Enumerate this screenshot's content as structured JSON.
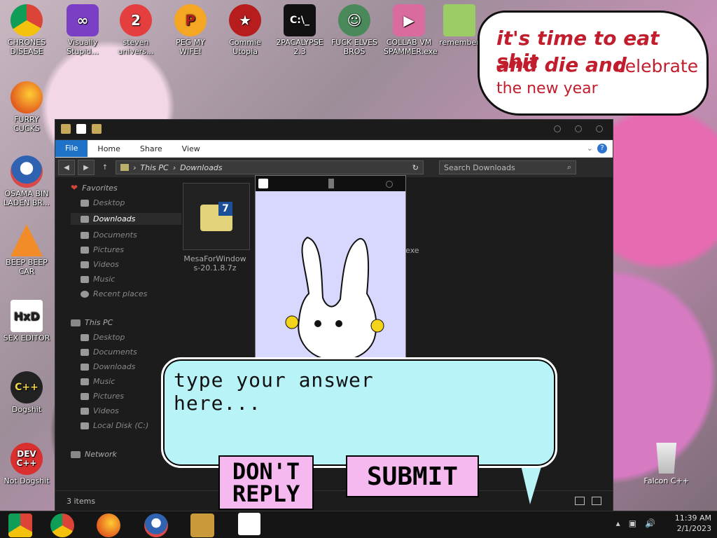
{
  "desktop": {
    "icons": [
      {
        "label": "CHRONES\nDISEASE"
      },
      {
        "label": "Visually\nStupid..."
      },
      {
        "label": "steven\nunivers..."
      },
      {
        "label": "PEG MY WIFE!"
      },
      {
        "label": "Commie\nUtopia"
      },
      {
        "label": "2PACALYPSE\n2.3"
      },
      {
        "label": "FUCK ELVES\nBROS"
      },
      {
        "label": "COLLAB VM\nSPAMMER.exe"
      },
      {
        "label": "remember"
      },
      {
        "label": "FURRY CUCKS"
      },
      {
        "label": "OSAMA BIN\nLADEN BR..."
      },
      {
        "label": "BEEP BEEP\nCAR"
      },
      {
        "label": "SEX EDITOR"
      },
      {
        "label": "Dogshit"
      },
      {
        "label": "Not Dogshit"
      },
      {
        "label": "Falcon C++"
      }
    ],
    "bubble_top": {
      "line1": "it's time to eat shit",
      "line2": "and die and",
      "line2b": "celebrate",
      "line3": "the new year"
    }
  },
  "explorer": {
    "tabs": [
      "File",
      "Home",
      "Share",
      "View"
    ],
    "address": [
      "This PC",
      "Downloads"
    ],
    "search_placeholder": "Search Downloads",
    "nav": {
      "favorites": "Favorites",
      "favorites_items": [
        "Desktop",
        "Downloads",
        "Documents",
        "Pictures",
        "Videos",
        "Music",
        "Recent places"
      ],
      "this_pc": "This PC",
      "this_pc_items": [
        "Desktop",
        "Documents",
        "Downloads",
        "Music",
        "Pictures",
        "Videos",
        "Local Disk (C:)"
      ],
      "network": "Network"
    },
    "file_name": "MesaForWindows-20.1.8.7z",
    "file_ext": "exe",
    "status": "3 items"
  },
  "dialog": {
    "prompt": "type your answer here...",
    "dont_reply": "DON'T\nREPLY",
    "submit": "SUBMIT"
  },
  "taskbar": {
    "time": "11:39 AM",
    "date": "2/1/2023"
  }
}
